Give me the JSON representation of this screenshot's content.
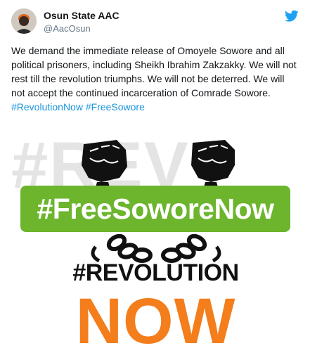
{
  "author": {
    "name": "Osun State AAC",
    "handle": "@AacOsun"
  },
  "icons": {
    "platform": "twitter-bird-icon"
  },
  "colors": {
    "link": "#1b95e0",
    "banner_green": "#6cb52d",
    "now_orange": "#f47d1c",
    "bird_blue": "#1da1f2"
  },
  "tweet": {
    "lines": [
      "We demand the immediate release of Omoyele Sowore and all",
      "political prisoners, including Sheikh Ibrahim Zakzakky. We will not",
      "rest till the revolution triumphs. We will not be deterred. We will",
      "not accept the continued incarceration of Comrade Sowore."
    ],
    "hashtags": [
      "#RevolutionNow",
      "#FreeSowore"
    ]
  },
  "media": {
    "background_text": "#REV",
    "banner_text": "#FreeSoworeNow",
    "headline": "#REVOLUTION",
    "big_word": "NOW"
  }
}
